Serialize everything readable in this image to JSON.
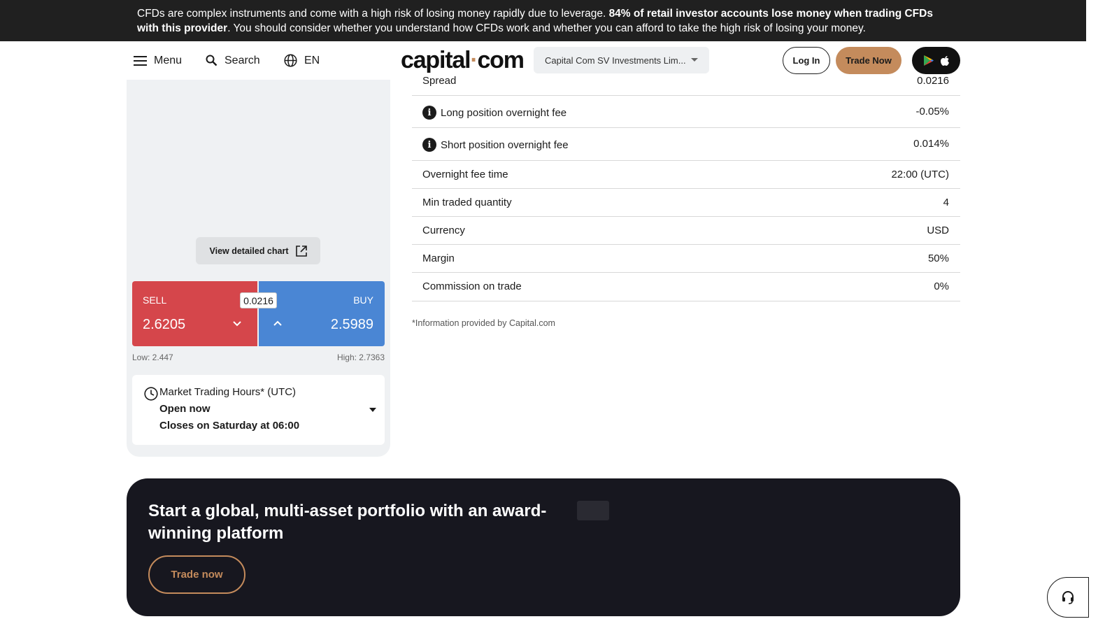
{
  "risk_banner": {
    "part1": "CFDs are complex instruments and come with a high risk of losing money rapidly due to leverage. ",
    "bold1": "84% of retail investor accounts lose money when trading CFDs",
    "bold2": "with this provider",
    "part2": ". You should consider whether you understand how CFDs work and whether you can afford to take the high risk of losing your money."
  },
  "header": {
    "menu_label": "Menu",
    "search_label": "Search",
    "language_label": "EN",
    "logo_left": "capital",
    "logo_dot": "·",
    "logo_right": "com",
    "entity_selected": "Capital Com SV Investments Lim...",
    "login_label": "Log In",
    "trade_now_label": "Trade Now"
  },
  "chart_panel": {
    "view_chart_label": "View detailed chart"
  },
  "trade_box": {
    "sell_label": "SELL",
    "sell_price": "2.6205",
    "buy_label": "BUY",
    "buy_price": "2.5989",
    "spread": "0.0216",
    "low": "Low: 2.447",
    "high": "High: 2.7363"
  },
  "trading_hours": {
    "title": "Market Trading Hours* (UTC)",
    "status": "Open now",
    "closes": "Closes on Saturday at 06:00"
  },
  "details": {
    "rows": [
      {
        "label": "Spread",
        "value": "0.0216",
        "info": false
      },
      {
        "label": "Long position overnight fee",
        "value": "-0.05%",
        "info": true
      },
      {
        "label": "Short position overnight fee",
        "value": "0.014%",
        "info": true
      },
      {
        "label": "Overnight fee time",
        "value": "22:00 (UTC)",
        "info": false
      },
      {
        "label": "Min traded quantity",
        "value": "4",
        "info": false
      },
      {
        "label": "Currency",
        "value": "USD",
        "info": false
      },
      {
        "label": "Margin",
        "value": "50%",
        "info": false
      },
      {
        "label": "Commission on trade",
        "value": "0%",
        "info": false
      }
    ],
    "footnote": "*Information provided by Capital.com"
  },
  "promo": {
    "title": "Start a global, multi-asset portfolio with an award-winning platform",
    "button_label": "Trade now"
  },
  "colors": {
    "sell": "#d5464b",
    "buy": "#4a86d4",
    "accent": "#c48b5c",
    "dark": "#17171f"
  }
}
